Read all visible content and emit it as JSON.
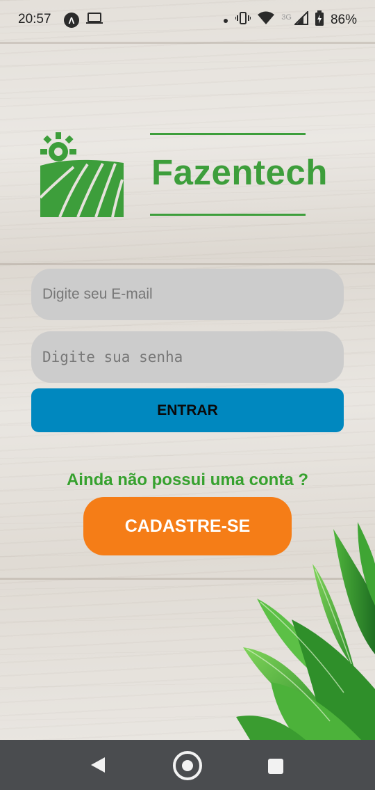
{
  "status_bar": {
    "time": "20:57",
    "network_label": "3G",
    "battery": "86%",
    "icons": [
      "navigation-a-icon",
      "laptop-icon",
      "dot-icon",
      "vibrate-icon",
      "wifi-icon",
      "signal-icon",
      "battery-icon"
    ]
  },
  "brand": {
    "name": "Fazentech",
    "color": "#3d9e3b"
  },
  "login_form": {
    "email_placeholder": "Digite seu E-mail",
    "password_placeholder": "Digite sua senha",
    "submit_label": "ENTRAR",
    "submit_color": "#0088bf"
  },
  "signup": {
    "prompt": "Ainda não possui uma conta ?",
    "button_label": "CADASTRE-SE",
    "button_color": "#f57d17"
  },
  "nav_bar": {
    "buttons": [
      "back-icon",
      "home-icon",
      "recents-icon"
    ]
  }
}
